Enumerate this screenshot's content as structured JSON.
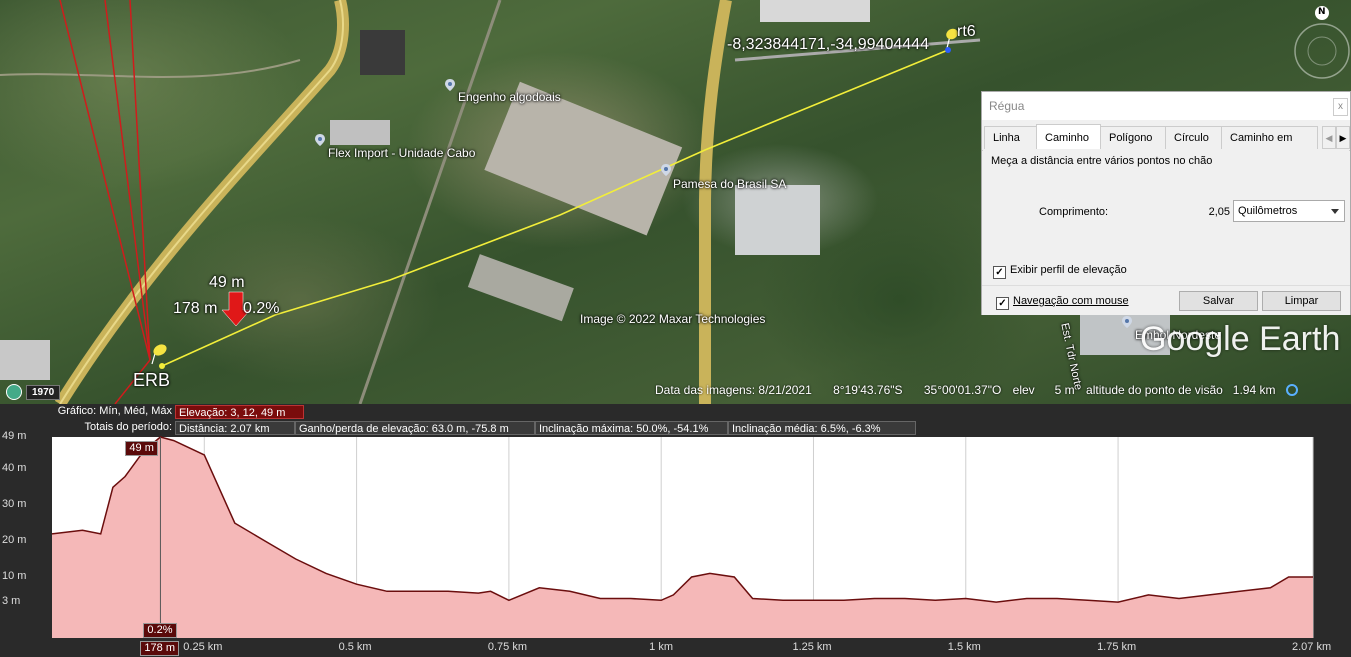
{
  "map": {
    "coord_label": "-8,323844171,-34,99404444",
    "pin_end_label": "rt6",
    "pin_start_label": "ERB",
    "marker_elevation": "49 m",
    "marker_distance": "178 m",
    "marker_slope": "0.2%",
    "places": {
      "engenho": "Engenho algodoais",
      "flex": "Flex Import - Unidade Cabo",
      "pamesa": "Pamesa do Brasil SA",
      "maxar": "Image © 2022 Maxar Technologies",
      "road": "Est. Tdr Norte",
      "emhol": "Emhol Nordeste"
    },
    "compass_label": "N",
    "year": "1970",
    "watermark": "Google Earth"
  },
  "status_bar": {
    "image_date": "Data das imagens: 8/21/2021",
    "lat": "8°19'43.76\"S",
    "lon": "35°00'01.37\"O",
    "elev": "elev      5 m",
    "eye_alt": "altitude do ponto de visão   1.94 km"
  },
  "ruler": {
    "title": "Régua",
    "close": "x",
    "tabs": [
      "Linha",
      "Caminho",
      "Polígono",
      "Círculo",
      "Caminho em 3D"
    ],
    "active_tab": "Caminho",
    "description": "Meça a distância entre vários pontos no chão",
    "length_label": "Comprimento:",
    "length_value": "2,05",
    "unit": "Quilômetros",
    "show_profile_label": "Exibir perfil de elevação",
    "mouse_nav_label": "Navegação com mouse",
    "save_label": "Salvar",
    "clear_label": "Limpar"
  },
  "profile": {
    "row1_label": "Gráfico: Mín, Méd, Máx",
    "row1_value": "Elevação: 3, 12, 49 m",
    "row2_label": "Totais do período:",
    "distance": "Distância: 2.07 km",
    "gain_loss": "Ganho/perda de elevação: 63.0 m, -75.8 m",
    "max_slope": "Inclinação máxima: 50.0%, -54.1%",
    "avg_slope": "Inclinação média: 6.5%, -6.3%",
    "cursor_elev": "49 m",
    "cursor_slope": "0.2%",
    "cursor_dist": "178 m"
  },
  "chart_data": {
    "type": "area",
    "x": [
      0,
      0.05,
      0.08,
      0.1,
      0.12,
      0.15,
      0.178,
      0.2,
      0.25,
      0.3,
      0.35,
      0.4,
      0.45,
      0.5,
      0.55,
      0.6,
      0.65,
      0.7,
      0.72,
      0.75,
      0.8,
      0.85,
      0.9,
      0.95,
      1.0,
      1.02,
      1.05,
      1.08,
      1.12,
      1.15,
      1.2,
      1.25,
      1.3,
      1.35,
      1.4,
      1.45,
      1.5,
      1.55,
      1.6,
      1.65,
      1.7,
      1.75,
      1.8,
      1.85,
      1.9,
      1.95,
      2.0,
      2.03,
      2.07
    ],
    "y": [
      22,
      23,
      22,
      35,
      38,
      45,
      49,
      48,
      44,
      25,
      20,
      15,
      11,
      8,
      6,
      6,
      6,
      5.5,
      6,
      3.5,
      7,
      6,
      4,
      4,
      3.5,
      5,
      10,
      11,
      10,
      4,
      3.5,
      3.5,
      3.5,
      4,
      4,
      3.5,
      4,
      3,
      4,
      4,
      3.5,
      3,
      5,
      4,
      5,
      6,
      7,
      10,
      10
    ],
    "xlim": [
      0,
      2.07
    ],
    "ylim": [
      -7,
      49
    ],
    "xtick_labels": [
      "0.25 km",
      "0.5 km",
      "0.75 km",
      "1 km",
      "1.25 km",
      "1.5 km",
      "1.75 km",
      "2.07 km"
    ],
    "xticks": [
      0.25,
      0.5,
      0.75,
      1.0,
      1.25,
      1.5,
      1.75,
      2.07
    ],
    "ytick_labels": [
      "49 m",
      "40 m",
      "30 m",
      "20 m",
      "10 m",
      "3 m"
    ],
    "yticks": [
      49,
      40,
      30,
      20,
      10,
      3
    ],
    "grid": true,
    "cursor_x": 0.178,
    "fill_color": "#f5b8b8",
    "line_color": "#6b0e0e"
  }
}
